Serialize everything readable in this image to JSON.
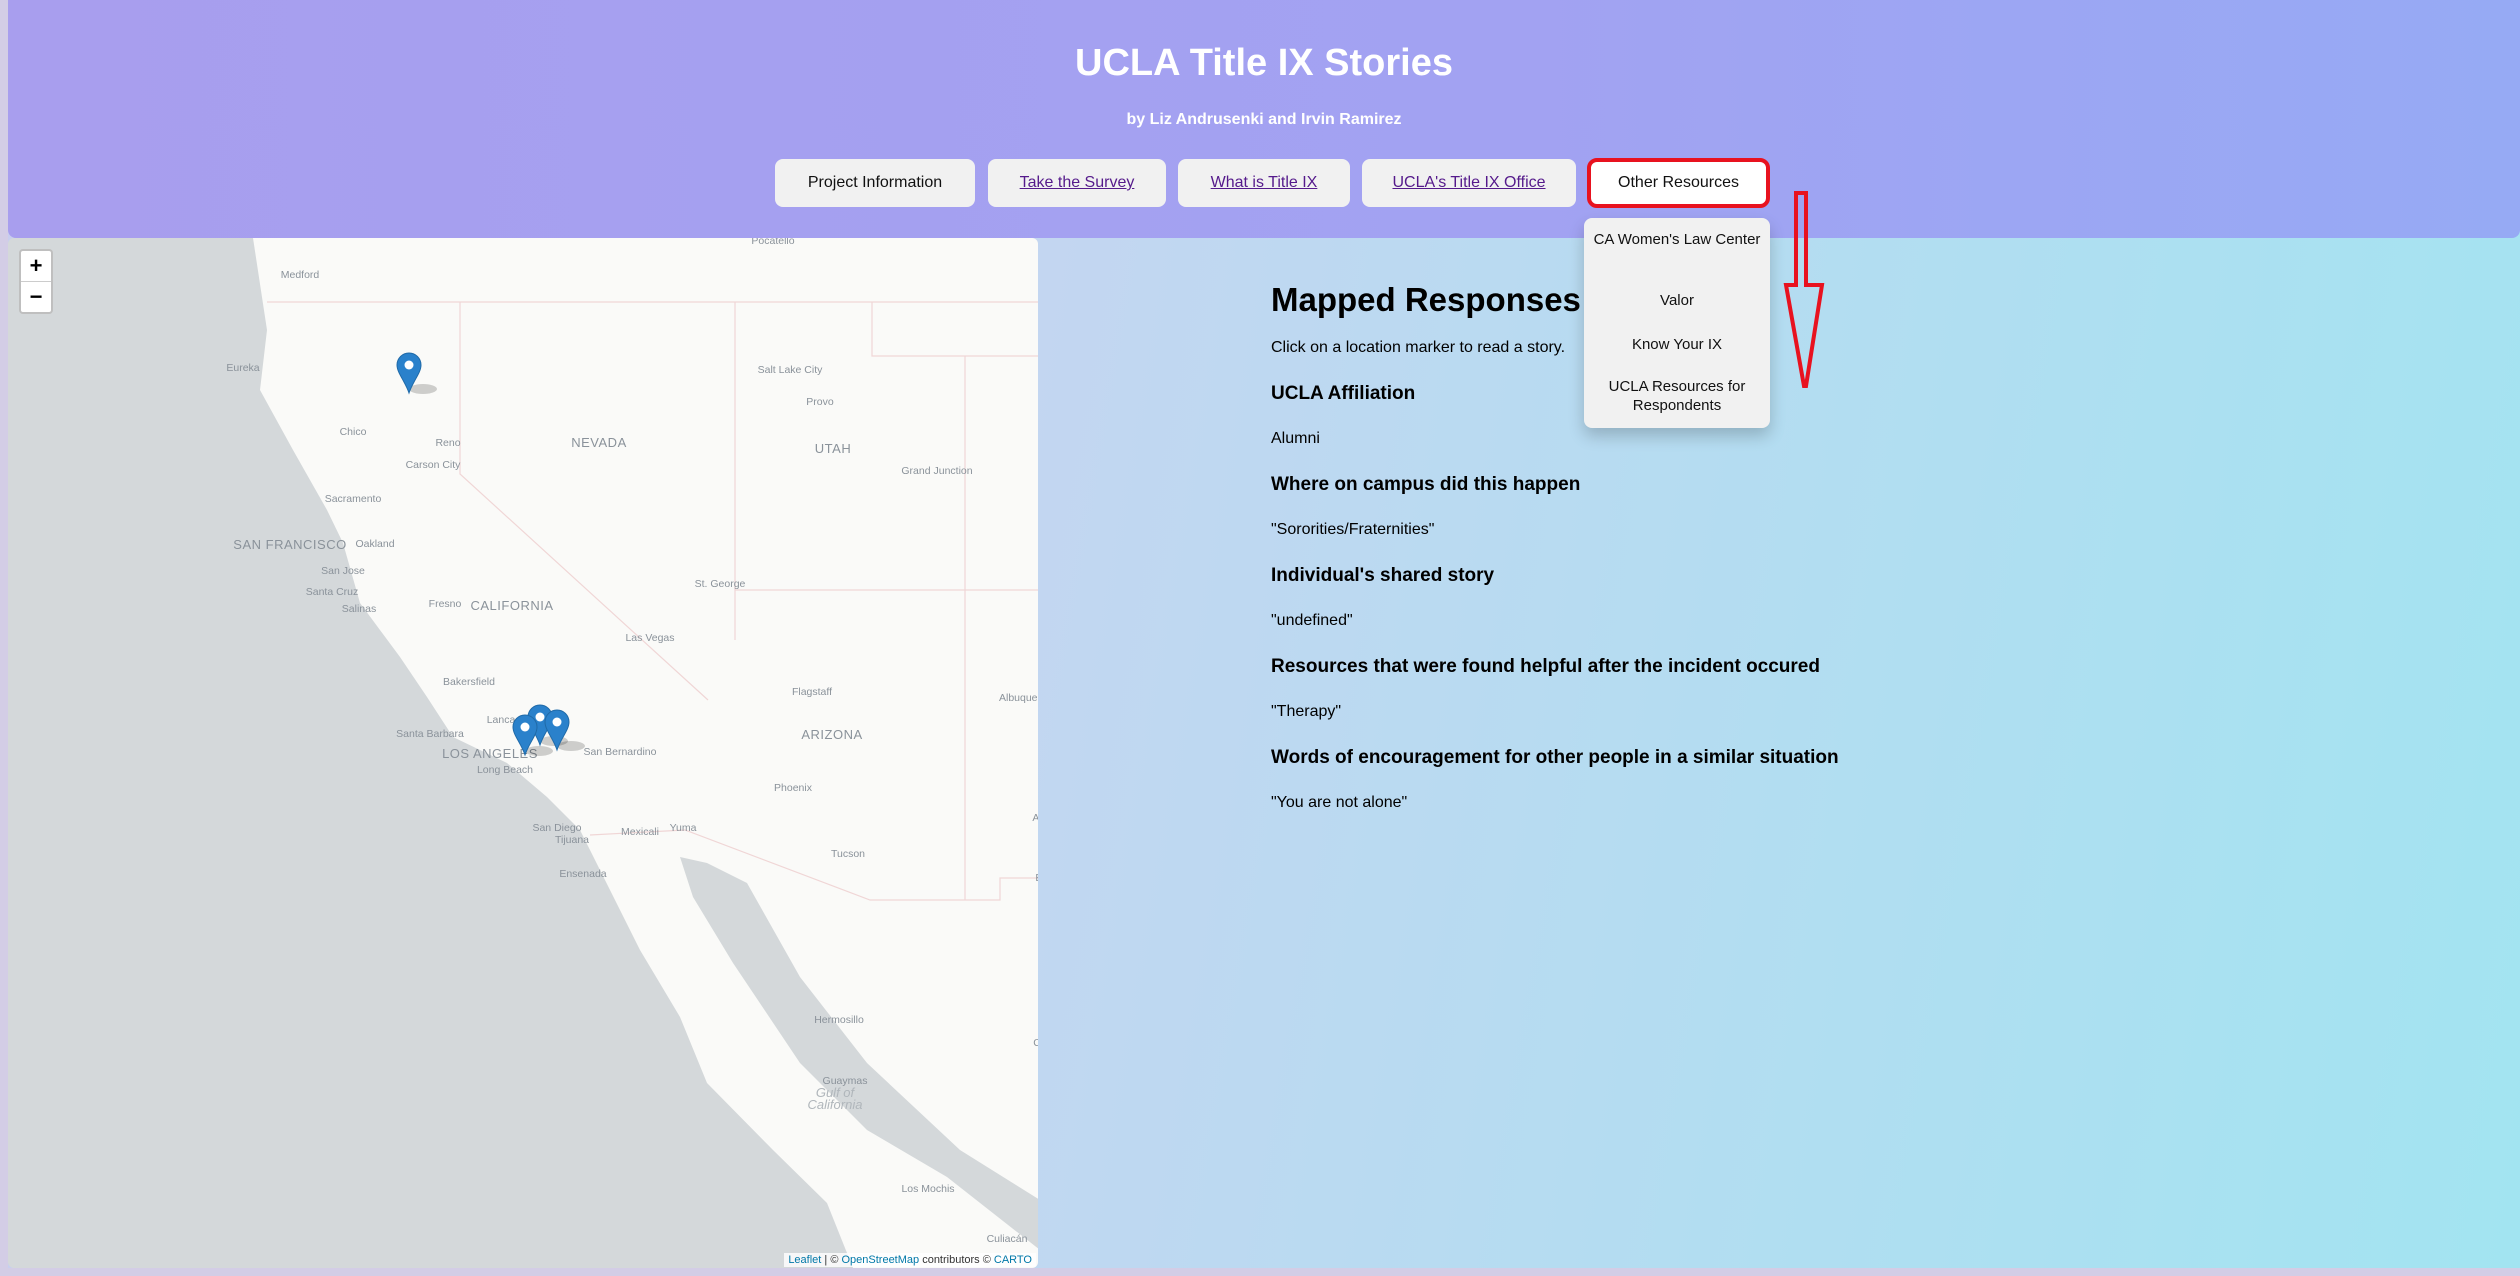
{
  "header": {
    "title": "UCLA Title IX Stories",
    "subtitle": "by Liz Andrusenki and Irvin Ramirez"
  },
  "nav": [
    {
      "label": "Project Information",
      "link": false
    },
    {
      "label": "Take the Survey",
      "link": true
    },
    {
      "label": "What is Title IX",
      "link": true
    },
    {
      "label": "UCLA's Title IX Office",
      "link": true
    },
    {
      "label": "Other Resources",
      "link": false,
      "highlighted": true
    }
  ],
  "dropdown": [
    "CA Women's Law Center",
    "Valor",
    "Know Your IX",
    "UCLA Resources for Respondents"
  ],
  "map": {
    "zoom_in": "+",
    "zoom_out": "−",
    "attribution": {
      "leaflet": "Leaflet",
      "sep": " | © ",
      "osm": "OpenStreetMap",
      "contrib": " contributors © ",
      "carto": "CARTO"
    },
    "labels": [
      "Pocatello",
      "Medford",
      "Eureka",
      "Salt Lake City",
      "Provo",
      "Chico",
      "Reno",
      "NEVADA",
      "UTAH",
      "Carson City",
      "Grand Junction",
      "Sacramento",
      "SAN FRANCISCO",
      "Oakland",
      "San Jose",
      "St. George",
      "Santa Cruz",
      "Fresno",
      "CALIFORNIA",
      "Salinas",
      "Las Vegas",
      "Bakersfield",
      "Flagstaff",
      "Albuquer",
      "Lanca",
      "Santa Barbara",
      "ARIZONA",
      "San Bernardino",
      "LOS ANGELES",
      "Long Beach",
      "Phoenix",
      "Al",
      "San Diego",
      "Mexicali",
      "Yuma",
      "Tijuana",
      "Tucson",
      "El",
      "Ensenada",
      "Hermosillo",
      "Ch",
      "Guaymas",
      "Gulf of",
      "California",
      "Los Mochis",
      "Culiacán"
    ],
    "marker_count": 4,
    "colors": {
      "ocean": "#d4d8da",
      "land": "#fafaf8",
      "marker": "#2a81cb"
    }
  },
  "content": {
    "title": "Mapped Responses",
    "instruction": "Click on a location marker to read a story.",
    "fields": [
      {
        "label": "UCLA Affiliation",
        "value": "Alumni"
      },
      {
        "label": "Where on campus did this happen",
        "value": "\"Sororities/Fraternities\""
      },
      {
        "label": "Individual's shared story",
        "value": "\"undefined\""
      },
      {
        "label": "Resources that were found helpful after the incident occured",
        "value": "\"Therapy\""
      },
      {
        "label": "Words of encouragement for other people in a similar situation",
        "value": "\"You are not alone\""
      }
    ]
  },
  "annotation_color": "#e8121f"
}
